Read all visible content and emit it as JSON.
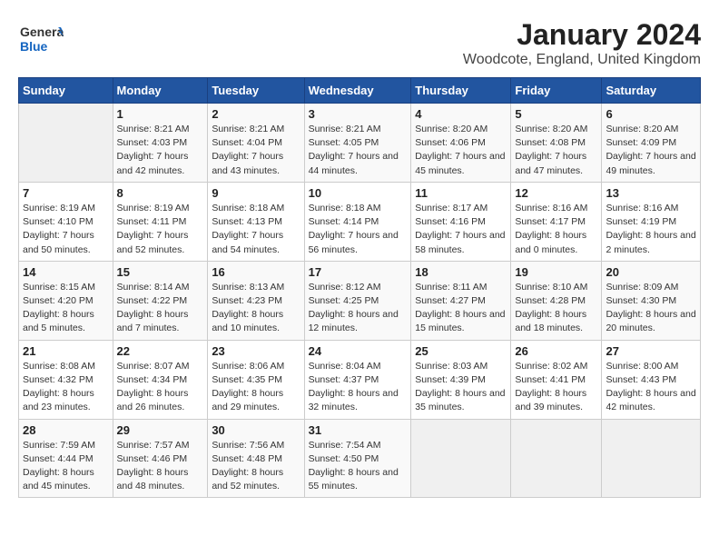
{
  "logo": {
    "text_general": "General",
    "text_blue": "Blue"
  },
  "title": "January 2024",
  "subtitle": "Woodcote, England, United Kingdom",
  "days_of_week": [
    "Sunday",
    "Monday",
    "Tuesday",
    "Wednesday",
    "Thursday",
    "Friday",
    "Saturday"
  ],
  "weeks": [
    [
      {
        "date": "",
        "sunrise": "",
        "sunset": "",
        "daylight": ""
      },
      {
        "date": "1",
        "sunrise": "Sunrise: 8:21 AM",
        "sunset": "Sunset: 4:03 PM",
        "daylight": "Daylight: 7 hours and 42 minutes."
      },
      {
        "date": "2",
        "sunrise": "Sunrise: 8:21 AM",
        "sunset": "Sunset: 4:04 PM",
        "daylight": "Daylight: 7 hours and 43 minutes."
      },
      {
        "date": "3",
        "sunrise": "Sunrise: 8:21 AM",
        "sunset": "Sunset: 4:05 PM",
        "daylight": "Daylight: 7 hours and 44 minutes."
      },
      {
        "date": "4",
        "sunrise": "Sunrise: 8:20 AM",
        "sunset": "Sunset: 4:06 PM",
        "daylight": "Daylight: 7 hours and 45 minutes."
      },
      {
        "date": "5",
        "sunrise": "Sunrise: 8:20 AM",
        "sunset": "Sunset: 4:08 PM",
        "daylight": "Daylight: 7 hours and 47 minutes."
      },
      {
        "date": "6",
        "sunrise": "Sunrise: 8:20 AM",
        "sunset": "Sunset: 4:09 PM",
        "daylight": "Daylight: 7 hours and 49 minutes."
      }
    ],
    [
      {
        "date": "7",
        "sunrise": "Sunrise: 8:19 AM",
        "sunset": "Sunset: 4:10 PM",
        "daylight": "Daylight: 7 hours and 50 minutes."
      },
      {
        "date": "8",
        "sunrise": "Sunrise: 8:19 AM",
        "sunset": "Sunset: 4:11 PM",
        "daylight": "Daylight: 7 hours and 52 minutes."
      },
      {
        "date": "9",
        "sunrise": "Sunrise: 8:18 AM",
        "sunset": "Sunset: 4:13 PM",
        "daylight": "Daylight: 7 hours and 54 minutes."
      },
      {
        "date": "10",
        "sunrise": "Sunrise: 8:18 AM",
        "sunset": "Sunset: 4:14 PM",
        "daylight": "Daylight: 7 hours and 56 minutes."
      },
      {
        "date": "11",
        "sunrise": "Sunrise: 8:17 AM",
        "sunset": "Sunset: 4:16 PM",
        "daylight": "Daylight: 7 hours and 58 minutes."
      },
      {
        "date": "12",
        "sunrise": "Sunrise: 8:16 AM",
        "sunset": "Sunset: 4:17 PM",
        "daylight": "Daylight: 8 hours and 0 minutes."
      },
      {
        "date": "13",
        "sunrise": "Sunrise: 8:16 AM",
        "sunset": "Sunset: 4:19 PM",
        "daylight": "Daylight: 8 hours and 2 minutes."
      }
    ],
    [
      {
        "date": "14",
        "sunrise": "Sunrise: 8:15 AM",
        "sunset": "Sunset: 4:20 PM",
        "daylight": "Daylight: 8 hours and 5 minutes."
      },
      {
        "date": "15",
        "sunrise": "Sunrise: 8:14 AM",
        "sunset": "Sunset: 4:22 PM",
        "daylight": "Daylight: 8 hours and 7 minutes."
      },
      {
        "date": "16",
        "sunrise": "Sunrise: 8:13 AM",
        "sunset": "Sunset: 4:23 PM",
        "daylight": "Daylight: 8 hours and 10 minutes."
      },
      {
        "date": "17",
        "sunrise": "Sunrise: 8:12 AM",
        "sunset": "Sunset: 4:25 PM",
        "daylight": "Daylight: 8 hours and 12 minutes."
      },
      {
        "date": "18",
        "sunrise": "Sunrise: 8:11 AM",
        "sunset": "Sunset: 4:27 PM",
        "daylight": "Daylight: 8 hours and 15 minutes."
      },
      {
        "date": "19",
        "sunrise": "Sunrise: 8:10 AM",
        "sunset": "Sunset: 4:28 PM",
        "daylight": "Daylight: 8 hours and 18 minutes."
      },
      {
        "date": "20",
        "sunrise": "Sunrise: 8:09 AM",
        "sunset": "Sunset: 4:30 PM",
        "daylight": "Daylight: 8 hours and 20 minutes."
      }
    ],
    [
      {
        "date": "21",
        "sunrise": "Sunrise: 8:08 AM",
        "sunset": "Sunset: 4:32 PM",
        "daylight": "Daylight: 8 hours and 23 minutes."
      },
      {
        "date": "22",
        "sunrise": "Sunrise: 8:07 AM",
        "sunset": "Sunset: 4:34 PM",
        "daylight": "Daylight: 8 hours and 26 minutes."
      },
      {
        "date": "23",
        "sunrise": "Sunrise: 8:06 AM",
        "sunset": "Sunset: 4:35 PM",
        "daylight": "Daylight: 8 hours and 29 minutes."
      },
      {
        "date": "24",
        "sunrise": "Sunrise: 8:04 AM",
        "sunset": "Sunset: 4:37 PM",
        "daylight": "Daylight: 8 hours and 32 minutes."
      },
      {
        "date": "25",
        "sunrise": "Sunrise: 8:03 AM",
        "sunset": "Sunset: 4:39 PM",
        "daylight": "Daylight: 8 hours and 35 minutes."
      },
      {
        "date": "26",
        "sunrise": "Sunrise: 8:02 AM",
        "sunset": "Sunset: 4:41 PM",
        "daylight": "Daylight: 8 hours and 39 minutes."
      },
      {
        "date": "27",
        "sunrise": "Sunrise: 8:00 AM",
        "sunset": "Sunset: 4:43 PM",
        "daylight": "Daylight: 8 hours and 42 minutes."
      }
    ],
    [
      {
        "date": "28",
        "sunrise": "Sunrise: 7:59 AM",
        "sunset": "Sunset: 4:44 PM",
        "daylight": "Daylight: 8 hours and 45 minutes."
      },
      {
        "date": "29",
        "sunrise": "Sunrise: 7:57 AM",
        "sunset": "Sunset: 4:46 PM",
        "daylight": "Daylight: 8 hours and 48 minutes."
      },
      {
        "date": "30",
        "sunrise": "Sunrise: 7:56 AM",
        "sunset": "Sunset: 4:48 PM",
        "daylight": "Daylight: 8 hours and 52 minutes."
      },
      {
        "date": "31",
        "sunrise": "Sunrise: 7:54 AM",
        "sunset": "Sunset: 4:50 PM",
        "daylight": "Daylight: 8 hours and 55 minutes."
      },
      {
        "date": "",
        "sunrise": "",
        "sunset": "",
        "daylight": ""
      },
      {
        "date": "",
        "sunrise": "",
        "sunset": "",
        "daylight": ""
      },
      {
        "date": "",
        "sunrise": "",
        "sunset": "",
        "daylight": ""
      }
    ]
  ]
}
